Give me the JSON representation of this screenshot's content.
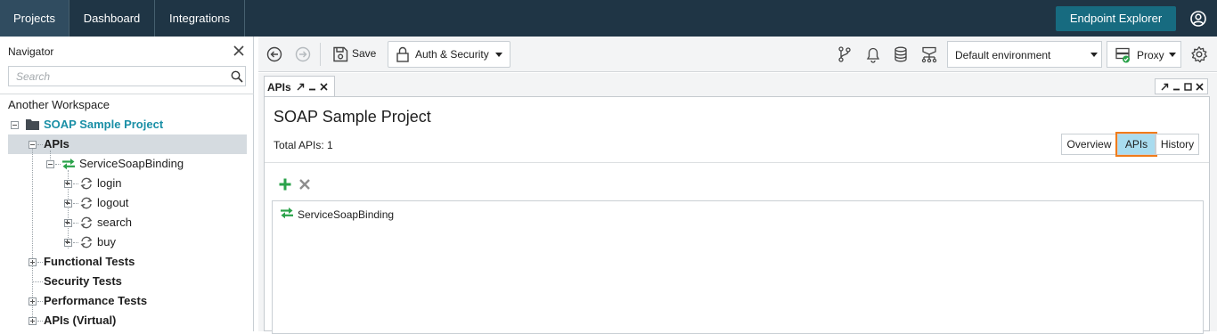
{
  "topbar": {
    "tabs": [
      {
        "label": "Projects",
        "active": true
      },
      {
        "label": "Dashboard",
        "active": false
      },
      {
        "label": "Integrations",
        "active": false
      }
    ],
    "endpoint_button": "Endpoint Explorer",
    "user_icon": "user-circle-icon"
  },
  "navigator": {
    "title": "Navigator",
    "search_placeholder": "Search",
    "workspace": "Another Workspace",
    "project": "SOAP Sample Project",
    "apis": "APIs",
    "binding": "ServiceSoapBinding",
    "operations": [
      "login",
      "logout",
      "search",
      "buy"
    ],
    "groups": [
      "Functional Tests",
      "Security Tests",
      "Performance Tests",
      "APIs (Virtual)"
    ]
  },
  "toolbar": {
    "save_label": "Save",
    "auth_label": "Auth & Security",
    "environment": "Default environment",
    "proxy_label": "Proxy"
  },
  "editor": {
    "tab_label": "APIs",
    "title": "SOAP Sample Project",
    "total_apis": "Total APIs: 1",
    "view_tabs": [
      {
        "label": "Overview",
        "active": false
      },
      {
        "label": "APIs",
        "active": true
      },
      {
        "label": "History",
        "active": false
      }
    ],
    "list_items": [
      "ServiceSoapBinding"
    ]
  },
  "colors": {
    "topbar_bg": "#1f3545",
    "accent_button": "#176b80",
    "teal_text": "#1a8fa6",
    "interface_green": "#2aa24a",
    "active_tab_bg": "#a9dcef",
    "highlight_outline": "#f07c1a"
  }
}
